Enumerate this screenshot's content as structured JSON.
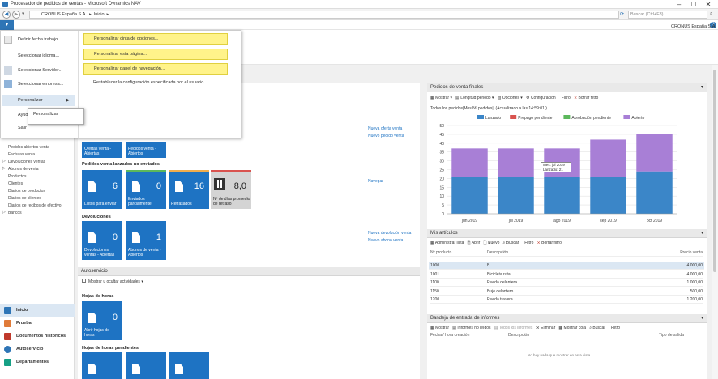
{
  "window": {
    "title": "Procesador de pedidos de ventas - Microsoft Dynamics NAV",
    "minimize": "–",
    "maximize": "☐",
    "close": "✕"
  },
  "address": {
    "crumbs": [
      "CRONUS España S.A.",
      "Inicio"
    ],
    "search_placeholder": "Buscar (Ctrl+F3)"
  },
  "company": "CRONUS España S.A.",
  "app_menu": {
    "items": [
      "Definir fecha trabajo...",
      "Seleccionar idioma...",
      "Seleccionar Servidor...",
      "Seleccionar empresa...",
      "Personalizar",
      "Ayuda",
      "Salir"
    ],
    "flyout": [
      "Personalizar cinta de opciones...",
      "Personalizar esta página...",
      "Personalizar panel de navegación...",
      "Restablecer la configuración especificada por el usuario..."
    ],
    "subpopup": "Personalizar"
  },
  "sidebar": {
    "items": [
      "Pedidos abiertos venta",
      "Facturas venta",
      "Devoluciones ventas",
      "Abonos de venta",
      "Productos",
      "Clientes",
      "Diarios de productos",
      "Diarios de clientes",
      "Diarios de recibos de efectivo",
      "Bancos"
    ],
    "sections": [
      "Inicio",
      "Prueba",
      "Documentos históricos",
      "Autoservicio",
      "Departamentos"
    ]
  },
  "activities": {
    "top_tiles": [
      "Ofertas venta - Abiertas",
      "Pedidos venta - Abiertos"
    ],
    "links_top": [
      "Nueva oferta venta",
      "Nuevo pedido venta"
    ],
    "released_title": "Pedidos venta lanzados no enviados",
    "released_tiles": [
      {
        "value": "6",
        "label": "Listos para enviar"
      },
      {
        "value": "0",
        "label": "Enviados parcialmente"
      },
      {
        "value": "16",
        "label": "Retrasados"
      },
      {
        "value": "8,0",
        "label": "Nº de días promedio de retraso"
      }
    ],
    "navigate_link": "Navegar",
    "returns_title": "Devoluciones",
    "returns_tiles": [
      {
        "value": "0",
        "label": "Devoluciones ventas - Abiertas"
      },
      {
        "value": "1",
        "label": "Abonos de venta - Abiertos"
      }
    ],
    "links_returns": [
      "Nueva devolución venta",
      "Nuevo abono venta"
    ]
  },
  "selfservice": {
    "title": "Autoservicio",
    "toggle": "Mostrar u ocultar actividades",
    "hours_title": "Hojas de horas",
    "hours_tile": {
      "value": "0",
      "label": "Abrir hojas de horas"
    },
    "pending_title": "Hojas de horas pendientes"
  },
  "chart_panel": {
    "title": "Pedidos de venta finales",
    "toolbar": [
      "Mostrar",
      "Longitud periodo",
      "Opciones",
      "Configuración",
      "Filtro",
      "Borrar filtro"
    ],
    "caption": "Todos los pedidos|Mes|Nº pedidos|. (Actualizado a las 14:59:01.)",
    "tooltip": [
      "Mes: jul 2019",
      "Lanzado: 21"
    ]
  },
  "chart_data": {
    "type": "bar",
    "stacked": true,
    "categories": [
      "jun 2019",
      "jul 2019",
      "ago 2019",
      "sep 2019",
      "oct 2019"
    ],
    "series": [
      {
        "name": "Lanzado",
        "color": "#3b86c8",
        "values": [
          21,
          21,
          21,
          21,
          24
        ]
      },
      {
        "name": "Prepago pendiente",
        "color": "#d9534f",
        "values": [
          0,
          0,
          0,
          0,
          0
        ]
      },
      {
        "name": "Aprobación pendiente",
        "color": "#5cb85c",
        "values": [
          0,
          0,
          0,
          0,
          0
        ]
      },
      {
        "name": "Abierto",
        "color": "#a87fd6",
        "values": [
          16,
          16,
          16,
          21,
          21
        ]
      }
    ],
    "yticks": [
      0,
      5,
      10,
      15,
      20,
      25,
      30,
      35,
      40,
      45,
      50
    ],
    "ylim": [
      0,
      50
    ],
    "legend": "top"
  },
  "items_panel": {
    "title": "Mis artículos",
    "toolbar": [
      "Administrar lista",
      "Abrir",
      "Nuevo",
      "Buscar",
      "Filtro",
      "Borrar filtro"
    ],
    "columns": [
      "Nº producto",
      "Descripción",
      "Precio venta"
    ],
    "rows": [
      [
        "1000",
        "B",
        "4.000,00"
      ],
      [
        "1001",
        "Bicicleta ruta",
        "4.000,00"
      ],
      [
        "1100",
        "Rueda delantera",
        "1.000,00"
      ],
      [
        "1150",
        "Buje delantero",
        "500,00"
      ],
      [
        "1200",
        "Rueda trasera",
        "1.200,00"
      ]
    ]
  },
  "reports_panel": {
    "title": "Bandeja de entrada de informes",
    "toolbar": [
      "Mostrar",
      "Informes no leídos",
      "Todos los informes",
      "Eliminar",
      "Mostrar cola",
      "Buscar",
      "Filtro"
    ],
    "columns": [
      "Fecha / hora creación",
      "Descripción",
      "Tipo de salida"
    ],
    "empty": "No hay nada que mostrar en esta vista."
  }
}
